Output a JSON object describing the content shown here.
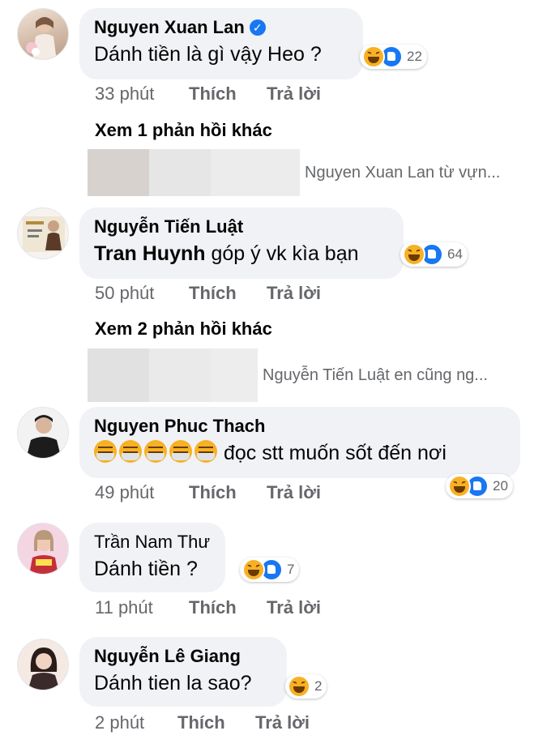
{
  "actions": {
    "like_label": "Thích",
    "reply_label": "Trả lời"
  },
  "comments": [
    {
      "author": "Nguyen Xuan Lan",
      "verified": true,
      "text": "Dánh tiền là gì vậy Heo ?",
      "reaction_count": "22",
      "time": "33 phút",
      "replies_label": "Xem 1 phản hồi khác",
      "reply_preview": "Nguyen Xuan Lan từ vựn..."
    },
    {
      "author": "Nguyễn Tiến Luật",
      "mention": "Tran Huynh",
      "text": " góp ý vk kìa bạn",
      "reaction_count": "64",
      "time": "50 phút",
      "replies_label": "Xem 2 phản hồi khác",
      "reply_preview": "Nguyễn Tiến Luật en cũng ng..."
    },
    {
      "author": "Nguyen Phuc Thach",
      "text": "đọc stt muốn sốt đến nơi",
      "reaction_count": "20",
      "time": "49 phút"
    },
    {
      "author": "Trần Nam Thư",
      "text": "Dánh tiền ?",
      "reaction_count": "7",
      "time": "11 phút"
    },
    {
      "author": "Nguyễn Lê Giang",
      "text": "Dánh tien la sao?",
      "reaction_count": "2",
      "time": "2 phút"
    }
  ],
  "icons": {
    "verified": "verified-check-icon",
    "haha": "haha-reaction-icon",
    "like": "like-reaction-icon",
    "emoji_repeat": "tired-face-emoji-icon"
  },
  "colors": {
    "bubble": "#f0f2f5",
    "meta": "#65676b",
    "like": "#1877f2",
    "haha": "#f7b125"
  }
}
